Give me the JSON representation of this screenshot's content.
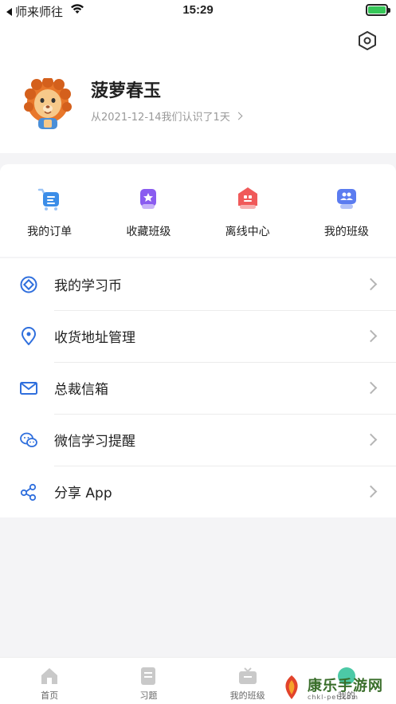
{
  "status_bar": {
    "back_label": "师来师往",
    "time": "15:29"
  },
  "profile": {
    "name": "菠萝春玉",
    "since_text": "从2021-12-14我们认识了1天"
  },
  "quick_actions": [
    {
      "label": "我的订单",
      "icon": "order-cart-icon",
      "color": "#3b8de8"
    },
    {
      "label": "收藏班级",
      "icon": "favorite-class-icon",
      "color": "#8a5cf0"
    },
    {
      "label": "离线中心",
      "icon": "offline-center-icon",
      "color": "#f05a5a"
    },
    {
      "label": "我的班级",
      "icon": "my-class-icon",
      "color": "#5b7cf0"
    }
  ],
  "menu": [
    {
      "label": "我的学习币",
      "icon": "coin-icon"
    },
    {
      "label": "收货地址管理",
      "icon": "location-pin-icon"
    },
    {
      "label": "总裁信箱",
      "icon": "mail-icon"
    },
    {
      "label": "微信学习提醒",
      "icon": "wechat-icon"
    },
    {
      "label": "分享 App",
      "icon": "share-icon"
    }
  ],
  "tabs": [
    {
      "label": "首页",
      "icon": "home-icon"
    },
    {
      "label": "习题",
      "icon": "exercise-icon"
    },
    {
      "label": "我的班级",
      "icon": "class-tv-icon"
    },
    {
      "label": "我的",
      "icon": "profile-icon"
    }
  ],
  "watermark": {
    "text": "康乐手游网",
    "sub": "chkl-pet.com"
  },
  "colors": {
    "accent": "#2f6fdd",
    "battery": "#37c759"
  }
}
